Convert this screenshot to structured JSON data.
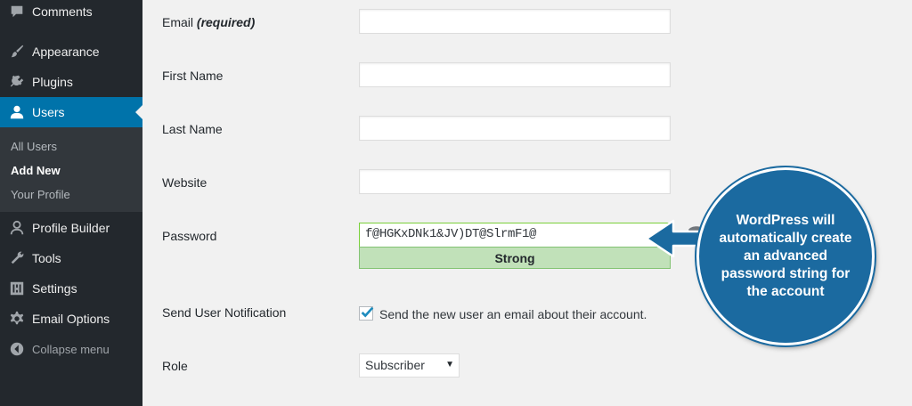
{
  "sidebar": {
    "items": [
      {
        "label": "Comments",
        "icon": "comment-icon"
      },
      {
        "label": "Appearance",
        "icon": "paintbrush-icon"
      },
      {
        "label": "Plugins",
        "icon": "plug-icon"
      },
      {
        "label": "Users",
        "icon": "user-icon"
      },
      {
        "label": "Profile Builder",
        "icon": "person-icon"
      },
      {
        "label": "Tools",
        "icon": "wrench-icon"
      },
      {
        "label": "Settings",
        "icon": "sliders-icon"
      },
      {
        "label": "Email Options",
        "icon": "gear-icon"
      },
      {
        "label": "Collapse menu",
        "icon": "collapse-icon"
      }
    ],
    "submenu": [
      "All Users",
      "Add New",
      "Your Profile"
    ],
    "accent": "#0073aa"
  },
  "form": {
    "email_label": "Email",
    "email_required": "(required)",
    "first_name_label": "First Name",
    "last_name_label": "Last Name",
    "website_label": "Website",
    "password_label": "Password",
    "password_value": "f@HGKxDNk1&JV)DT@SlrmF1@",
    "password_strength": "Strong",
    "notification_label": "Send User Notification",
    "notification_text": "Send the new user an email about their account.",
    "notification_checked": true,
    "role_label": "Role",
    "role_value": "Subscriber"
  },
  "callout": {
    "text": "WordPress will automatically create an advanced password string for the account",
    "color": "#1b6aa0"
  }
}
